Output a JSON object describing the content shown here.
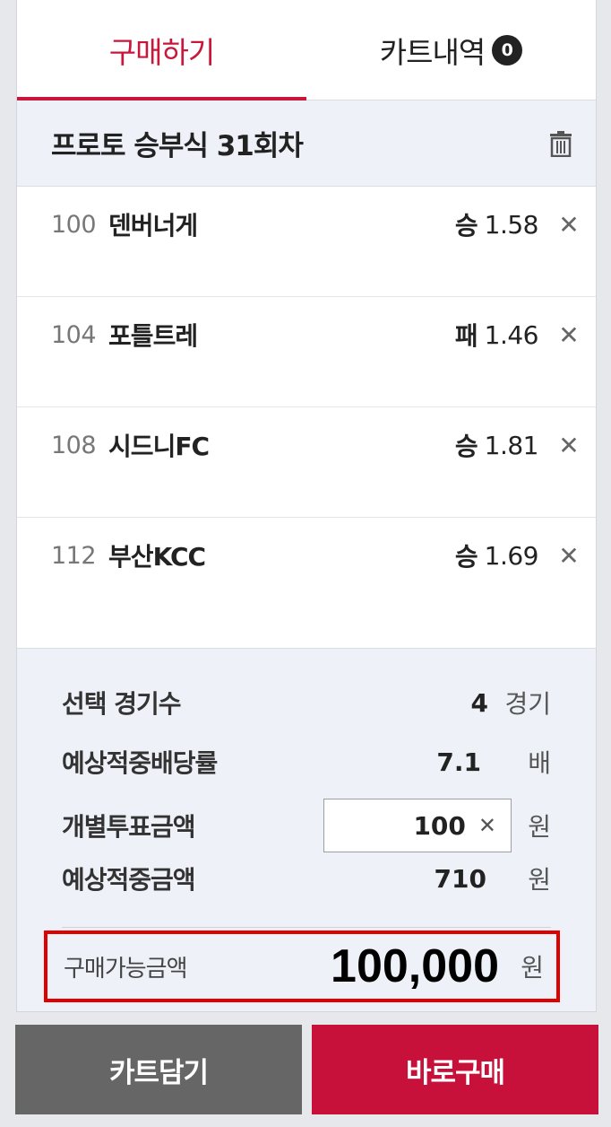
{
  "tabs": [
    {
      "label": "구매하기"
    },
    {
      "label": "카트내역",
      "count": "0"
    }
  ],
  "game": {
    "title": "프로토 승부식 31회차"
  },
  "picks": [
    {
      "no": "100",
      "team": "덴버너게",
      "result": "승",
      "odds": "1.58"
    },
    {
      "no": "104",
      "team": "포틀트레",
      "result": "패",
      "odds": "1.46"
    },
    {
      "no": "108",
      "team": "시드니FC",
      "result": "승",
      "odds": "1.81"
    },
    {
      "no": "112",
      "team": "부산KCC",
      "result": "승",
      "odds": "1.69"
    }
  ],
  "summary": {
    "games_label": "선택 경기수",
    "games_value": "4",
    "games_unit": "경기",
    "odds_label": "예상적중배당률",
    "odds_value": "7.1",
    "odds_unit": "배",
    "bet_label": "개별투표금액",
    "bet_value": "100",
    "bet_unit": "원",
    "expected_label": "예상적중금액",
    "expected_value": "710",
    "expected_unit": "원",
    "available_label": "구매가능금액",
    "available_value": "100,000",
    "available_unit": "원"
  },
  "buttons": {
    "cart": "카트담기",
    "buy": "바로구매"
  },
  "colors": {
    "accent": "#c8173b",
    "highlight_border": "#e10000",
    "cart_button": "#666666",
    "buy_button": "#c8113a"
  }
}
